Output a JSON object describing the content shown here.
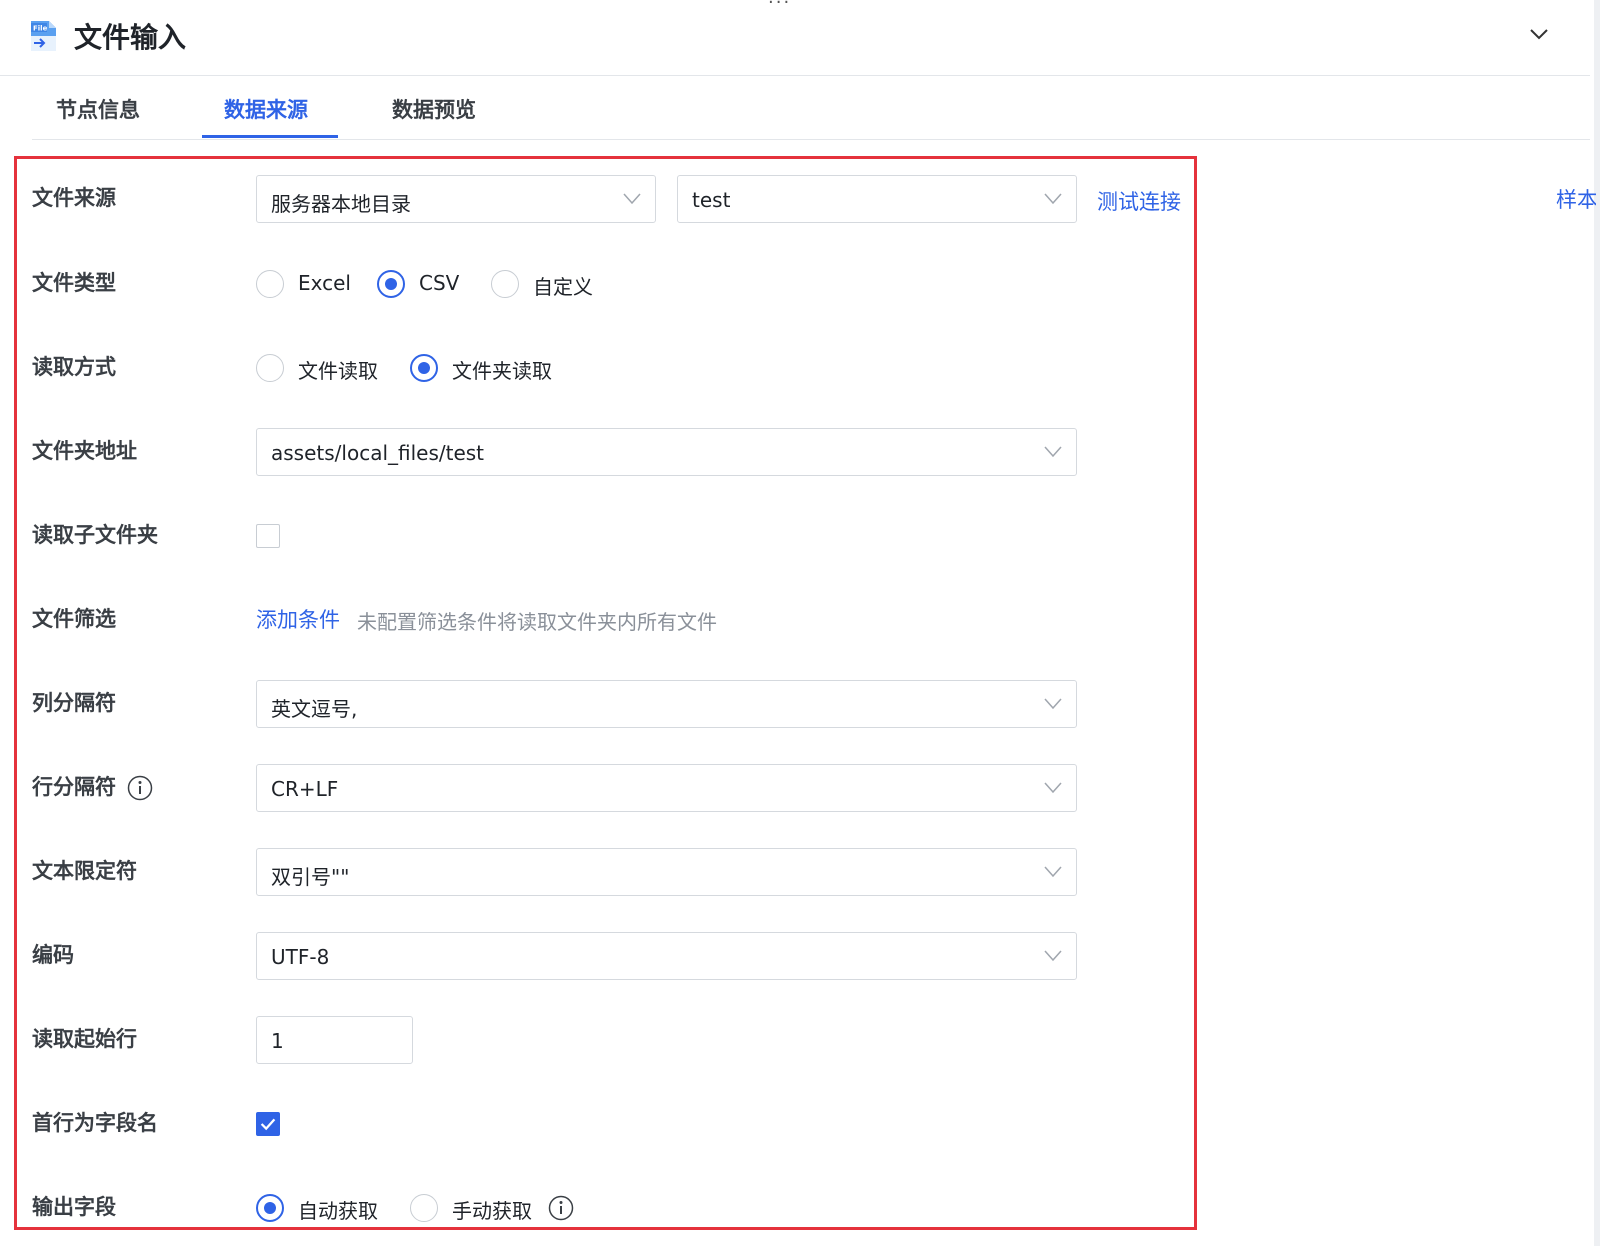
{
  "header": {
    "title": "文件输入",
    "icon": "file-input-icon",
    "collapse_icon": "chevron-down-icon"
  },
  "tabs": [
    {
      "label": "节点信息",
      "active": false
    },
    {
      "label": "数据来源",
      "active": true
    },
    {
      "label": "数据预览",
      "active": false
    }
  ],
  "side_link": "样本",
  "form": {
    "file_source": {
      "label": "文件来源",
      "source_type": "服务器本地目录",
      "connection": "test",
      "test_link": "测试连接"
    },
    "file_type": {
      "label": "文件类型",
      "options": [
        "Excel",
        "CSV",
        "自定义"
      ],
      "selected": "CSV"
    },
    "read_mode": {
      "label": "读取方式",
      "options": [
        "文件读取",
        "文件夹读取"
      ],
      "selected": "文件夹读取"
    },
    "folder_path": {
      "label": "文件夹地址",
      "value": "assets/local_files/test"
    },
    "read_subfolders": {
      "label": "读取子文件夹",
      "checked": false
    },
    "file_filter": {
      "label": "文件筛选",
      "add_link": "添加条件",
      "hint": "未配置筛选条件将读取文件夹内所有文件"
    },
    "column_separator": {
      "label": "列分隔符",
      "value": "英文逗号,"
    },
    "row_separator": {
      "label": "行分隔符",
      "value": "CR+LF"
    },
    "text_qualifier": {
      "label": "文本限定符",
      "value": "双引号\"\""
    },
    "encoding": {
      "label": "编码",
      "value": "UTF-8"
    },
    "start_row": {
      "label": "读取起始行",
      "value": "1"
    },
    "first_row_header": {
      "label": "首行为字段名",
      "checked": true
    },
    "output_fields": {
      "label": "输出字段",
      "options": [
        "自动获取",
        "手动获取"
      ],
      "selected": "自动获取"
    }
  },
  "colors": {
    "accent": "#2f63e6",
    "highlight_border": "#e5323c"
  }
}
